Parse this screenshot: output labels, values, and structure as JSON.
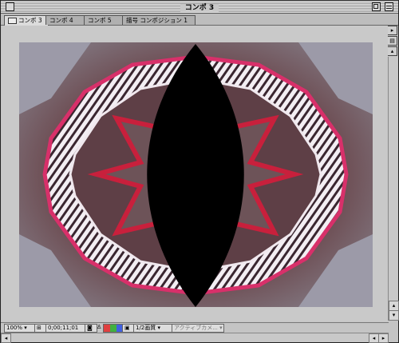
{
  "window": {
    "title": "コンポ 3"
  },
  "tabs": [
    {
      "label": "コンポ 3"
    },
    {
      "label": "コンポ 4"
    },
    {
      "label": "コンポ 5"
    },
    {
      "label": "描号 コンポジション 1"
    }
  ],
  "bottom": {
    "zoom": "100%",
    "timecode": "0;00;11;01",
    "resolution": "1/2画質",
    "camera": "アクティブカメ..."
  }
}
